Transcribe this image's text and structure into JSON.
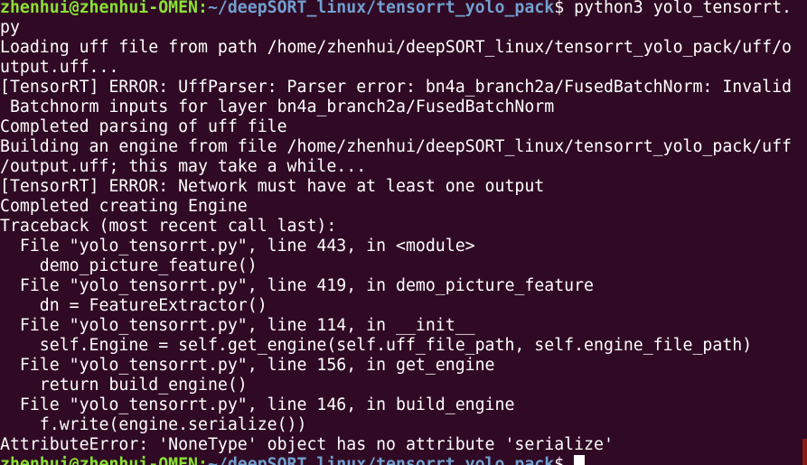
{
  "terminal": {
    "prompt": {
      "user_host": "zhenhui@zhenhui-OMEN",
      "separator": ":",
      "path": "~/deepSORT_linux/tensorrt_yolo_pack",
      "symbol": "$",
      "command_part1": " python3 yolo_tensorrt.",
      "command_part2": "py"
    },
    "output_lines": [
      "Loading uff file from path /home/zhenhui/deepSORT_linux/tensorrt_yolo_pack/uff/o",
      "utput.uff...",
      "[TensorRT] ERROR: UffParser: Parser error: bn4a_branch2a/FusedBatchNorm: Invalid",
      " Batchnorm inputs for layer bn4a_branch2a/FusedBatchNorm",
      "Completed parsing of uff file",
      "Building an engine from file /home/zhenhui/deepSORT_linux/tensorrt_yolo_pack/uff",
      "/output.uff; this may take a while...",
      "[TensorRT] ERROR: Network must have at least one output",
      "Completed creating Engine",
      "Traceback (most recent call last):",
      "  File \"yolo_tensorrt.py\", line 443, in <module>",
      "    demo_picture_feature()",
      "  File \"yolo_tensorrt.py\", line 419, in demo_picture_feature",
      "    dn = FeatureExtractor()",
      "  File \"yolo_tensorrt.py\", line 114, in __init__",
      "    self.Engine = self.get_engine(self.uff_file_path, self.engine_file_path)",
      "  File \"yolo_tensorrt.py\", line 156, in get_engine",
      "    return build_engine()",
      "  File \"yolo_tensorrt.py\", line 146, in build_engine",
      "    f.write(engine.serialize())",
      "AttributeError: 'NoneType' object has no attribute 'serialize'"
    ],
    "final_prompt": {
      "user_host": "zhenhui@zhenhui-OMEN",
      "separator": ":",
      "path": "~/deepSORT_linux/tensorrt_yolo_pack",
      "symbol": "$",
      "command": " "
    },
    "colors": {
      "background": "#300a24",
      "text": "#ffffff",
      "prompt_user": "#8ae234",
      "prompt_path": "#729fcf",
      "scrollbar": "#8b1a14"
    }
  }
}
